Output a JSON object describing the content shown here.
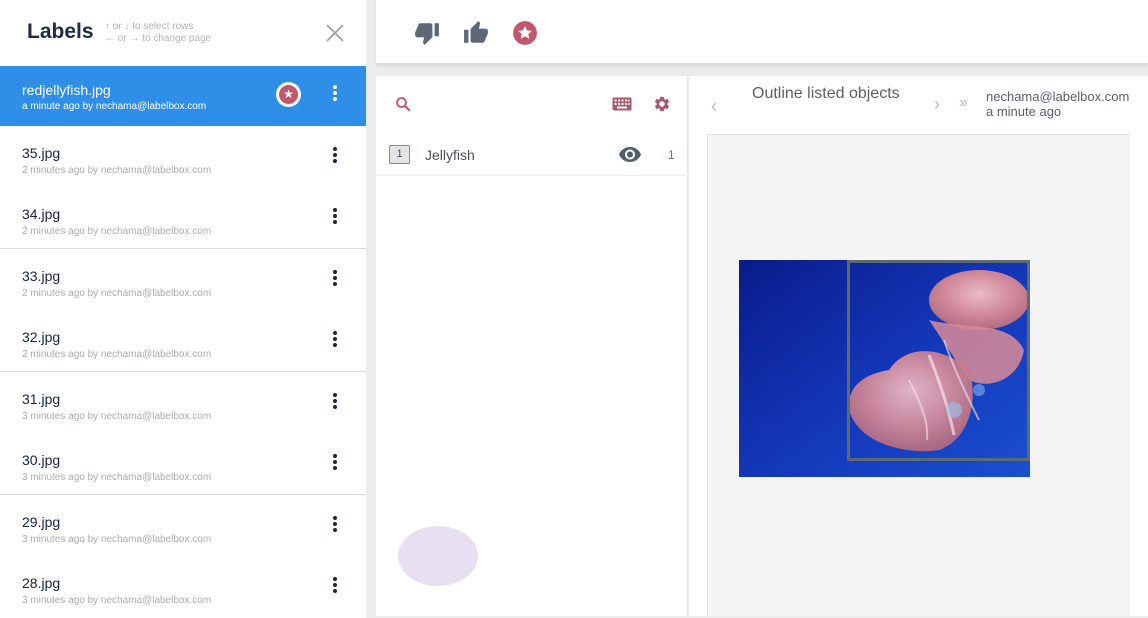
{
  "sidebar": {
    "title": "Labels",
    "hint_line1": "↑ or ↓ to select rows",
    "hint_line2": "← or → to change page",
    "items": [
      {
        "name": "redjellyfish.jpg",
        "meta": "a minute ago by nechama@labelbox.com",
        "active": true,
        "starred": true
      },
      {
        "name": "35.jpg",
        "meta": "2 minutes ago by nechama@labelbox.com"
      },
      {
        "name": "34.jpg",
        "meta": "2 minutes ago by nechama@labelbox.com"
      },
      {
        "name": "33.jpg",
        "meta": "2 minutes ago by nechama@labelbox.com"
      },
      {
        "name": "32.jpg",
        "meta": "2 minutes ago by nechama@labelbox.com"
      },
      {
        "name": "31.jpg",
        "meta": "3 minutes ago by nechama@labelbox.com"
      },
      {
        "name": "30.jpg",
        "meta": "3 minutes ago by nechama@labelbox.com"
      },
      {
        "name": "29.jpg",
        "meta": "3 minutes ago by nechama@labelbox.com"
      },
      {
        "name": "28.jpg",
        "meta": "3 minutes ago by nechama@labelbox.com"
      }
    ]
  },
  "toolbar": {
    "icons": [
      "thumbs-down-icon",
      "thumbs-up-icon",
      "star-icon"
    ]
  },
  "tools": {
    "items": [
      {
        "key": "1",
        "name": "Jellyfish",
        "count": "1"
      }
    ]
  },
  "canvas": {
    "instruction": "Outline listed objects",
    "author": "nechama@labelbox.com",
    "time": "a minute ago"
  },
  "colors": {
    "accent": "#2f8fe8",
    "star": "#c2566b",
    "icon": "#5d6775"
  }
}
